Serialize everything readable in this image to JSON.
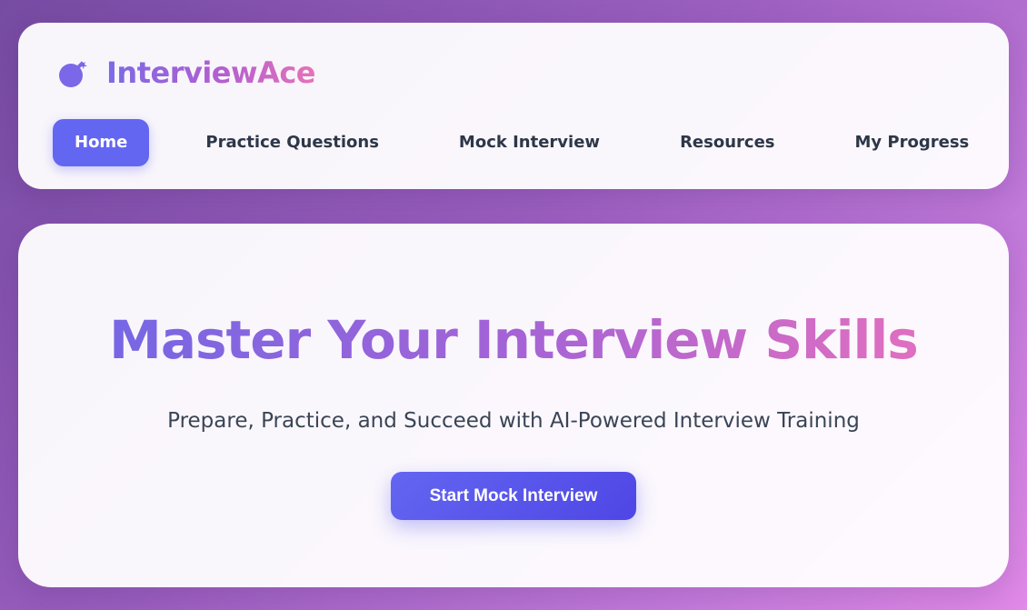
{
  "brand": {
    "icon": "bomb-icon",
    "name": "InterviewAce"
  },
  "nav": {
    "items": [
      {
        "label": "Home",
        "active": true
      },
      {
        "label": "Practice Questions",
        "active": false
      },
      {
        "label": "Mock Interview",
        "active": false
      },
      {
        "label": "Resources",
        "active": false
      },
      {
        "label": "My Progress",
        "active": false
      }
    ]
  },
  "hero": {
    "title": "Master Your Interview Skills",
    "subtitle": "Prepare, Practice, and Succeed with AI-Powered Interview Training",
    "cta_label": "Start Mock Interview"
  },
  "colors": {
    "accent": "#6366f1",
    "gradient_start": "#7667e4",
    "gradient_end": "#e06fc0",
    "background_start": "#764ba2",
    "background_end": "#e28ae8"
  }
}
